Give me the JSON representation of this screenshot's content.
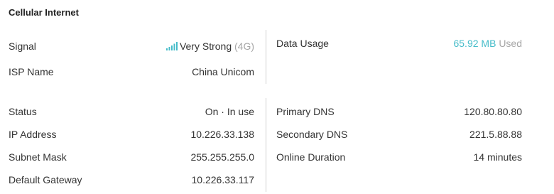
{
  "section": {
    "title": "Cellular Internet"
  },
  "signal": {
    "label": "Signal",
    "strength": "Very Strong",
    "network": "(4G)",
    "icon": "signal-bars-icon",
    "level": 1.0
  },
  "isp": {
    "label": "ISP Name",
    "value": "China Unicom"
  },
  "data_usage": {
    "label": "Data Usage",
    "amount": "65.92 MB",
    "suffix": "Used"
  },
  "status": {
    "label": "Status",
    "value": "On · In use"
  },
  "ip_address": {
    "label": "IP Address",
    "value": "10.226.33.138"
  },
  "subnet_mask": {
    "label": "Subnet Mask",
    "value": "255.255.255.0"
  },
  "default_gateway": {
    "label": "Default Gateway",
    "value": "10.226.33.117"
  },
  "primary_dns": {
    "label": "Primary DNS",
    "value": "120.80.80.80"
  },
  "secondary_dns": {
    "label": "Secondary DNS",
    "value": "221.5.88.88"
  },
  "online_duration": {
    "label": "Online Duration",
    "value": "14 minutes"
  },
  "colors": {
    "accent": "#45bcc9",
    "muted": "#a6a6a6",
    "text": "#333333",
    "divider": "#cfcfcf"
  }
}
